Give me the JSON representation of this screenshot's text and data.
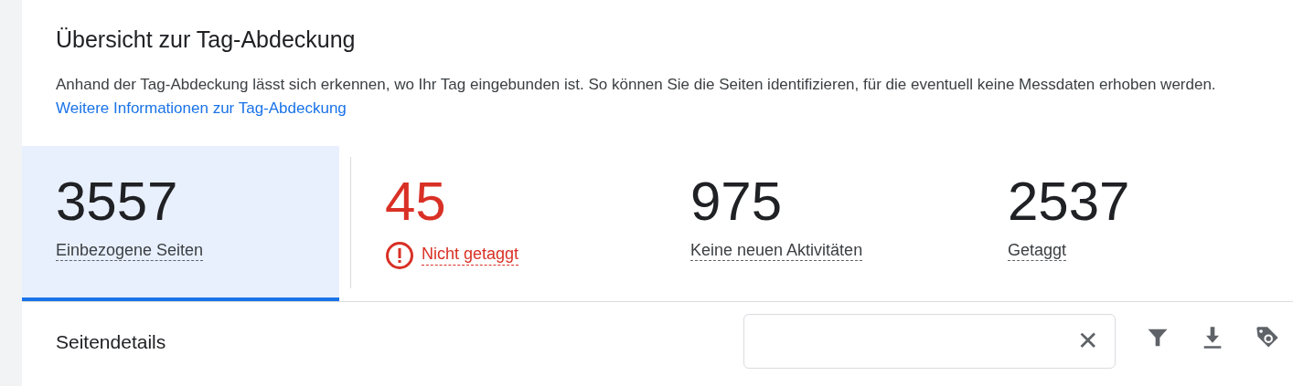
{
  "title": "Übersicht zur Tag-Abdeckung",
  "description": "Anhand der Tag-Abdeckung lässt sich erkennen, wo Ihr Tag eingebunden ist. So können Sie die Seiten identifizieren, für die eventuell keine Messdaten erhoben werden.",
  "link": "Weitere Informationen zur Tag-Abdeckung",
  "metrics": [
    {
      "value": "3557",
      "label": "Einbezogene Seiten",
      "kind": "normal",
      "selected": true
    },
    {
      "value": "45",
      "label": "Nicht getaggt",
      "kind": "error",
      "selected": false
    },
    {
      "value": "975",
      "label": "Keine neuen Aktivitäten",
      "kind": "normal",
      "selected": false
    },
    {
      "value": "2537",
      "label": "Getaggt",
      "kind": "normal",
      "selected": false
    }
  ],
  "details": {
    "title": "Seitendetails",
    "search": {
      "clear": "✕"
    }
  }
}
